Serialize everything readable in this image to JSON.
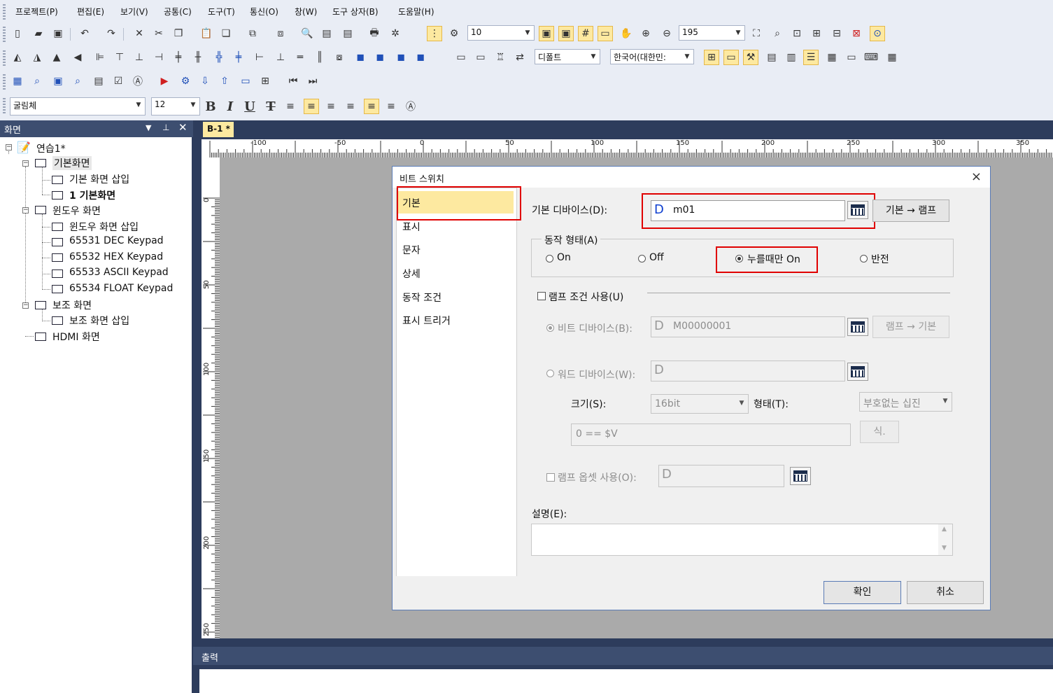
{
  "menu": [
    "프로젝트(P)",
    "편집(E)",
    "보기(V)",
    "공통(C)",
    "도구(T)",
    "통신(O)",
    "창(W)",
    "도구 상자(B)",
    "도움말(H)"
  ],
  "toolbar": {
    "grid_size": "10",
    "zoom": "195",
    "style_combo": "디폴트",
    "language_combo": "한국어(대한민:",
    "font_name": "굴림체",
    "font_size": "12",
    "bold": "B",
    "italic": "I",
    "underline": "U",
    "strike": "T"
  },
  "left_panel": {
    "title": "화면",
    "tree": [
      "연습1*",
      "기본화면",
      "기본 화면 삽입",
      "1 기본화면",
      "윈도우 화면",
      "윈도우 화면 삽입",
      "65531 DEC Keypad",
      "65532 HEX Keypad",
      "65533 ASCII Keypad",
      "65534 FLOAT Keypad",
      "보조 화면",
      "보조 화면 삽입",
      "HDMI 화면"
    ]
  },
  "editor": {
    "tab": "B-1 *",
    "ruler_top": [
      "-100",
      "-50",
      "0",
      "50",
      "100",
      "150",
      "200",
      "250",
      "300",
      "350"
    ],
    "ruler_left": [
      "0",
      "50",
      "100",
      "150",
      "200",
      "250"
    ]
  },
  "output_panel": {
    "title": "출력"
  },
  "dialog": {
    "title": "비트 스위치",
    "close": "×",
    "nav": [
      "기본",
      "표시",
      "문자",
      "상세",
      "동작 조건",
      "표시 트리거"
    ],
    "base_device_label": "기본 디바이스(D):",
    "base_device_prefix": "D",
    "base_device_value": "m01",
    "base_to_lamp": "기본 → 램프",
    "action_label": "동작 형태(A)",
    "action_options": [
      "On",
      "Off",
      "누를때만 On",
      "반전"
    ],
    "lamp_condition_label": "램프 조건 사용(U)",
    "bit_device_label": "비트 디바이스(B):",
    "bit_device_prefix": "D",
    "bit_device_value": "M00000001",
    "lamp_to_base": "램프 → 기본",
    "word_device_label": "워드 디바이스(W):",
    "word_device_prefix": "D",
    "size_label": "크기(S):",
    "size_value": "16bit",
    "type_label": "형태(T):",
    "type_value": "부호없는 십진",
    "expression": "0 == $V",
    "expr_button": "식.",
    "lamp_offset_label": "램프 옵셋 사용(O):",
    "lamp_offset_prefix": "D",
    "desc_label": "설명(E):",
    "ok": "확인",
    "cancel": "취소"
  }
}
